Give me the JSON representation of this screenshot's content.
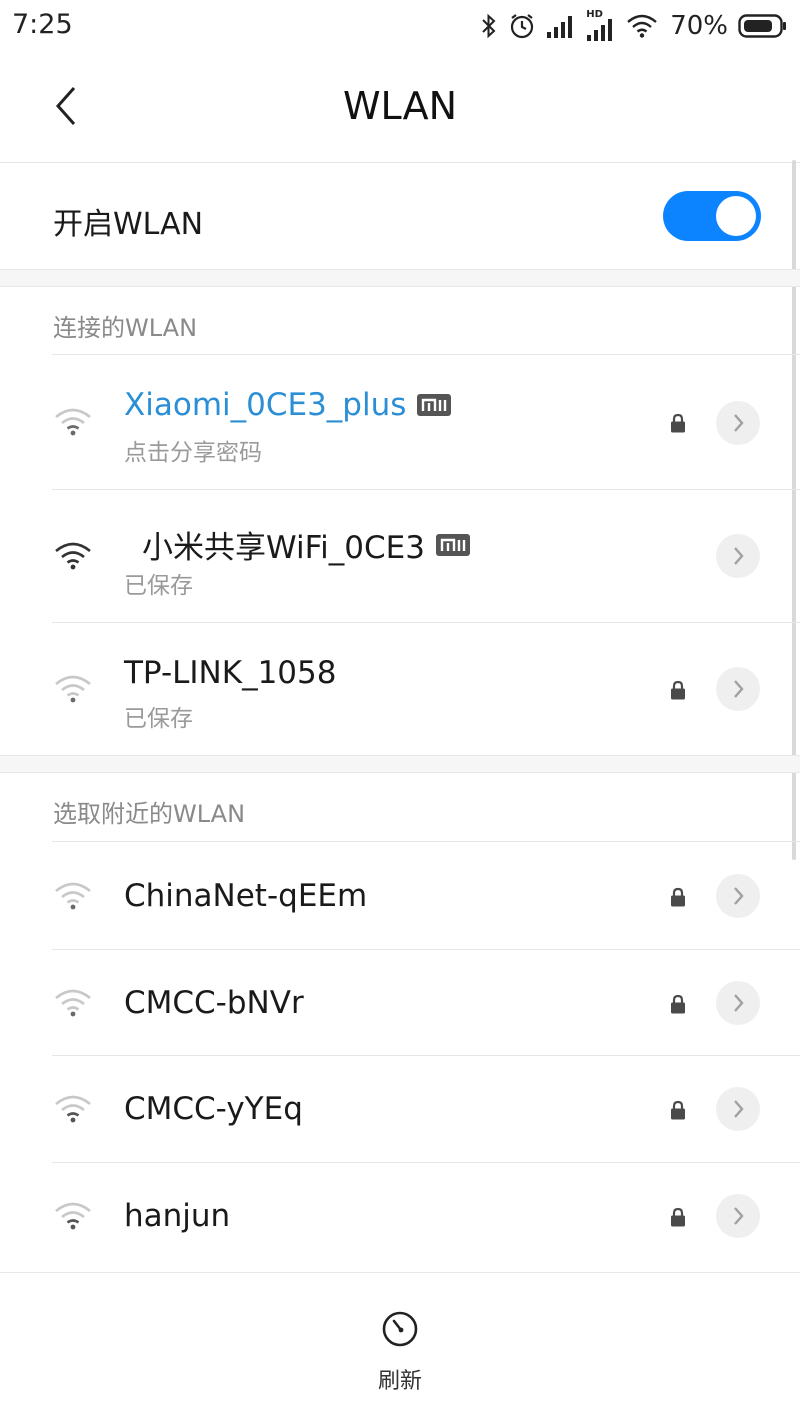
{
  "status_bar": {
    "time": "7:25",
    "battery_percent": "70%",
    "network_label": "HD",
    "icons": [
      "bluetooth-icon",
      "alarm-icon",
      "signal-icon",
      "signal-hd-icon",
      "wifi-icon",
      "battery-icon"
    ]
  },
  "header": {
    "title": "WLAN",
    "back_icon": "chevron-left-icon"
  },
  "wlan_toggle": {
    "label": "开启WLAN",
    "enabled": true,
    "accent_color": "#0d84ff"
  },
  "connected_section": {
    "header": "连接的WLAN",
    "networks": [
      {
        "name": "Xiaomi_0CE3_plus",
        "status": "点击分享密码",
        "secured": true,
        "mi_badge": true,
        "signal": "weak",
        "active": true
      },
      {
        "name": "小米共享WiFi_0CE3",
        "status": "已保存",
        "secured": false,
        "mi_badge": true,
        "signal": "strong",
        "active": false
      },
      {
        "name": "TP-LINK_1058",
        "status": "已保存",
        "secured": true,
        "mi_badge": false,
        "signal": "weak",
        "active": false
      }
    ]
  },
  "nearby_section": {
    "header": "选取附近的WLAN",
    "networks": [
      {
        "name": "ChinaNet-qEEm",
        "secured": true,
        "signal": "weak"
      },
      {
        "name": "CMCC-bNVr",
        "secured": true,
        "signal": "weak"
      },
      {
        "name": "CMCC-yYEq",
        "secured": true,
        "signal": "medium"
      },
      {
        "name": "hanjun",
        "secured": true,
        "signal": "medium"
      }
    ]
  },
  "bottom_bar": {
    "refresh_label": "刷新",
    "refresh_icon": "refresh-icon"
  },
  "colors": {
    "active_network": "#2c8fd6",
    "toggle_on": "#0d84ff"
  }
}
